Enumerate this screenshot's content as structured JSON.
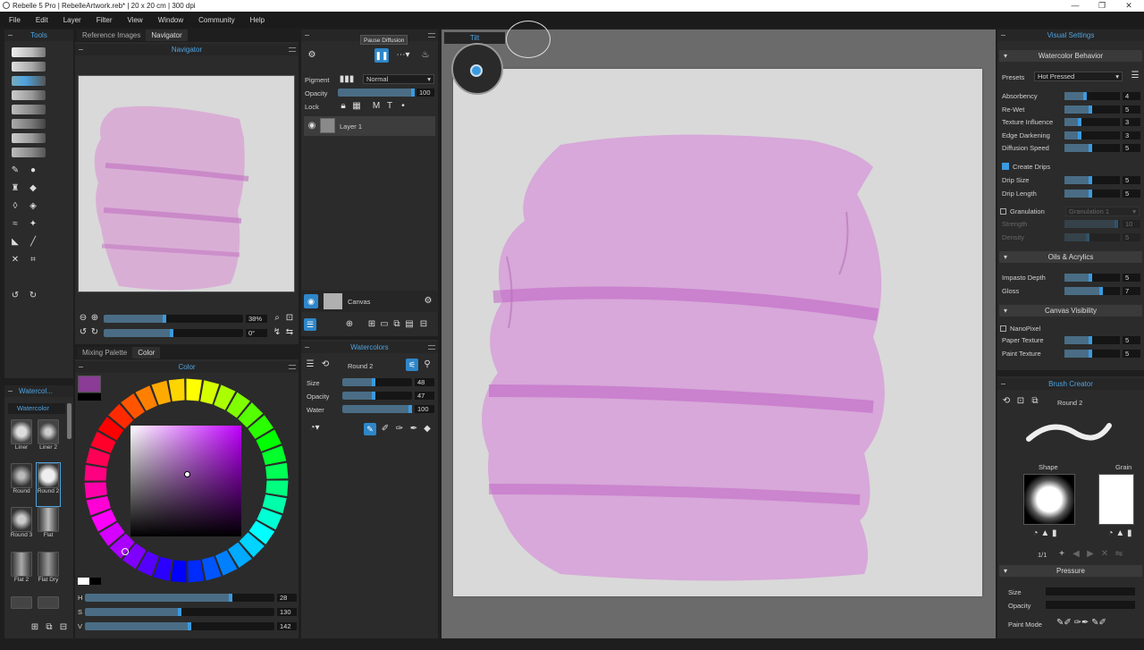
{
  "window": {
    "title": "Rebelle 5 Pro | RebelleArtwork.reb* | 20 x 20 cm | 300 dpi",
    "minimize": "—",
    "maximize": "❐",
    "close": "✕"
  },
  "menu": [
    "File",
    "Edit",
    "Layer",
    "Filter",
    "View",
    "Window",
    "Community",
    "Help"
  ],
  "tools_panel": {
    "title": "Tools"
  },
  "left_tabs": {
    "reference": "Reference Images",
    "navigator": "Navigator"
  },
  "navigator": {
    "title": "Navigator",
    "zoom": "38%",
    "rotation": "0°",
    "zoom_level": 0.45,
    "rotation_level": 0.5
  },
  "color_tabs": {
    "mixing": "Mixing Palette",
    "color": "Color"
  },
  "color_panel": {
    "title": "Color",
    "current_color": "#8a3c96",
    "h_label": "H",
    "h": "28",
    "s_label": "S",
    "s": "130",
    "v_label": "V",
    "v": "142",
    "h_level": 0.78,
    "s_level": 0.51,
    "v_level": 0.56
  },
  "brushes_panel": {
    "title": "Watercol...",
    "set_name": "Watercolor",
    "brushes": [
      "Liner",
      "Liner 2",
      "Round",
      "Round 2",
      "Round 3",
      "Flat",
      "Flat 2",
      "Flat Dry"
    ]
  },
  "layers_panel": {
    "tooltip": "Pause Diffusion",
    "pigment_label": "Pigment",
    "blend_mode": "Normal",
    "opacity_label": "Opacity",
    "opacity": "100",
    "opacity_level": 1.0,
    "lock_label": "Lock",
    "lock_m": "M",
    "lock_t": "T",
    "layer_name": "Layer 1",
    "canvas_label": "Canvas"
  },
  "watercolors_panel": {
    "title": "Watercolors",
    "brush_name": "Round 2",
    "size_label": "Size",
    "size": "48",
    "size_level": 0.48,
    "opacity_label": "Opacity",
    "opacity": "47",
    "opacity_level": 0.47,
    "water_label": "Water",
    "water": "100",
    "water_level": 1.0
  },
  "tilt": {
    "title": "Tilt"
  },
  "visual_settings": {
    "title": "Visual Settings",
    "watercolor_behavior": "Watercolor Behavior",
    "presets_label": "Presets",
    "preset": "Hot Pressed",
    "rows": [
      {
        "label": "Absorbency",
        "value": "4",
        "level": 0.4
      },
      {
        "label": "Re-Wet",
        "value": "5",
        "level": 0.5
      },
      {
        "label": "Texture Influence",
        "value": "3",
        "level": 0.3
      },
      {
        "label": "Edge Darkening",
        "value": "3",
        "level": 0.3
      },
      {
        "label": "Diffusion Speed",
        "value": "5",
        "level": 0.5
      }
    ],
    "create_drips": "Create Drips",
    "drip_rows": [
      {
        "label": "Drip Size",
        "value": "5",
        "level": 0.5
      },
      {
        "label": "Drip Length",
        "value": "5",
        "level": 0.5
      }
    ],
    "granulation": "Granulation",
    "granulation_preset": "Granulation 1",
    "gran_rows": [
      {
        "label": "Strength",
        "value": "10",
        "level": 0.97
      },
      {
        "label": "Density",
        "value": "5",
        "level": 0.45
      }
    ],
    "oils_acrylics": "Oils & Acrylics",
    "oil_rows": [
      {
        "label": "Impasto Depth",
        "value": "5",
        "level": 0.5
      },
      {
        "label": "Gloss",
        "value": "7",
        "level": 0.7
      }
    ],
    "canvas_visibility": "Canvas Visibility",
    "nanopixel": "NanoPixel",
    "canvas_rows": [
      {
        "label": "Paper Texture",
        "value": "5",
        "level": 0.5
      },
      {
        "label": "Paint Texture",
        "value": "5",
        "level": 0.5
      }
    ]
  },
  "brush_creator": {
    "title": "Brush Creator",
    "brush_name": "Round 2",
    "shape_label": "Shape",
    "grain_label": "Grain",
    "page": "1/1",
    "pressure": "Pressure",
    "size_label": "Size",
    "opacity_label": "Opacity",
    "paint_mode": "Paint Mode"
  }
}
